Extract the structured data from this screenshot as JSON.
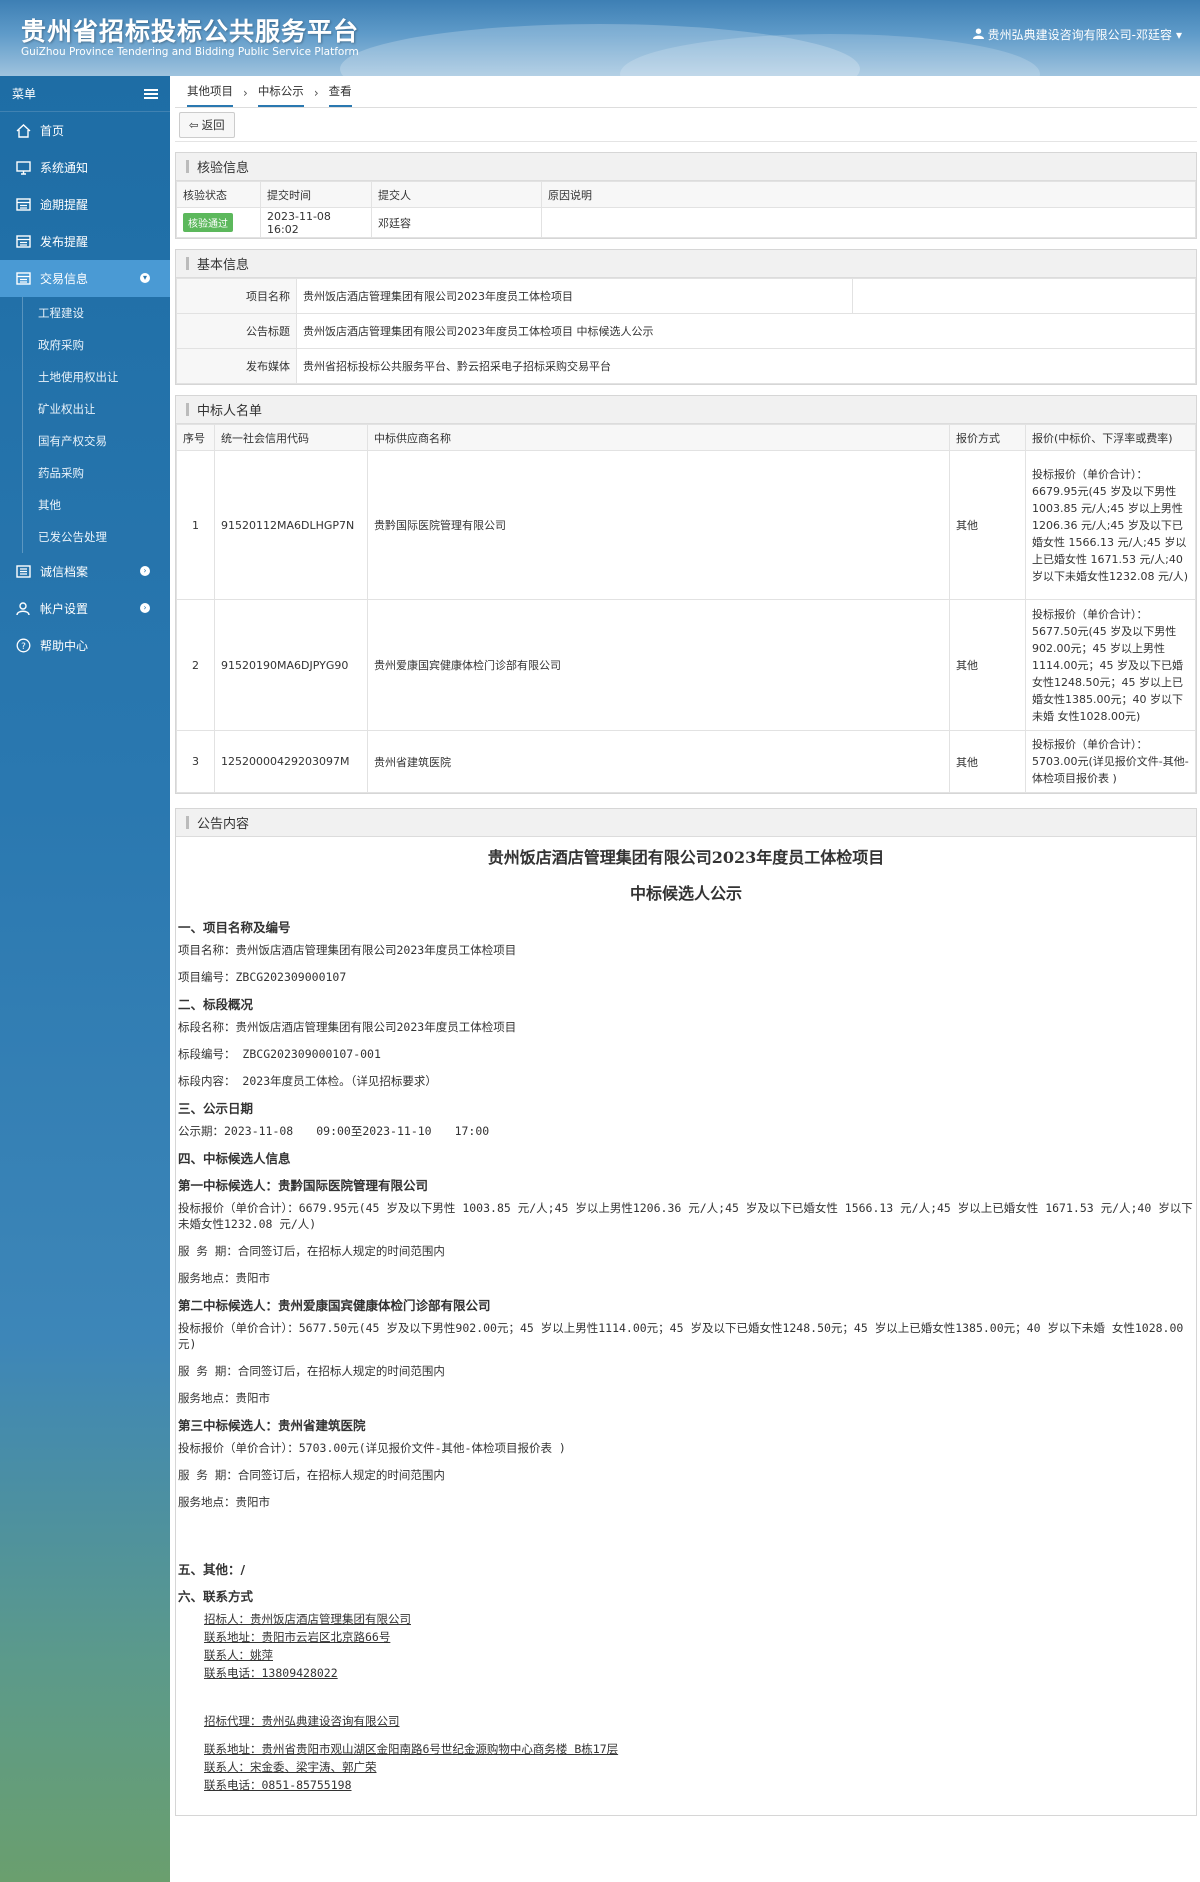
{
  "header": {
    "title": "贵州省招标投标公共服务平台",
    "subtitle": "GuiZhou Province Tendering and Bidding Public Service Platform",
    "user": "贵州弘典建设咨询有限公司-邓廷容"
  },
  "sidebar": {
    "menu_label": "菜单",
    "items": [
      {
        "label": "首页",
        "icon": "home-icon"
      },
      {
        "label": "系统通知",
        "icon": "monitor-icon"
      },
      {
        "label": "逾期提醒",
        "icon": "list-icon"
      },
      {
        "label": "发布提醒",
        "icon": "list-icon"
      },
      {
        "label": "交易信息",
        "icon": "list-icon"
      }
    ],
    "sub_items": [
      "工程建设",
      "政府采购",
      "土地使用权出让",
      "矿业权出让",
      "国有产权交易",
      "药品采购",
      "其他",
      "已发公告处理"
    ],
    "bottom_items": [
      {
        "label": "诚信档案",
        "icon": "list-icon"
      },
      {
        "label": "帐户设置",
        "icon": "user-icon"
      },
      {
        "label": "帮助中心",
        "icon": "help-icon"
      }
    ]
  },
  "breadcrumb": [
    "其他项目",
    "中标公示",
    "查看"
  ],
  "toolbar": {
    "back_label": "返回"
  },
  "verify": {
    "title": "核验信息",
    "headers": [
      "核验状态",
      "提交时间",
      "提交人",
      "原因说明"
    ],
    "status": "核验通过",
    "time": "2023-11-08 16:02",
    "submitter": "邓廷容",
    "reason": ""
  },
  "basic": {
    "title": "基本信息",
    "rows": [
      {
        "label": "项目名称",
        "value": "贵州饭店酒店管理集团有限公司2023年度员工体检项目"
      },
      {
        "label": "公告标题",
        "value": "贵州饭店酒店管理集团有限公司2023年度员工体检项目 中标候选人公示"
      },
      {
        "label": "发布媒体",
        "value": "贵州省招标投标公共服务平台、黔云招采电子招标采购交易平台"
      }
    ]
  },
  "winners": {
    "title": "中标人名单",
    "headers": [
      "序号",
      "统一社会信用代码",
      "中标供应商名称",
      "报价方式",
      "报价(中标价、下浮率或费率)"
    ],
    "rows": [
      {
        "no": "1",
        "code": "91520112MA6DLHGP7N",
        "name": "贵黔国际医院管理有限公司",
        "method": "其他",
        "price": "投标报价（单价合计）：6679.95元(45 岁及以下男性1003.85 元/人;45 岁以上男性1206.36 元/人;45 岁及以下已婚女性 1566.13 元/人;45 岁以上已婚女性 1671.53 元/人;40 岁以下未婚女性1232.08 元/人)"
      },
      {
        "no": "2",
        "code": "91520190MA6DJPYG90",
        "name": "贵州爱康国宾健康体检门诊部有限公司",
        "method": "其他",
        "price": "投标报价（单价合计）：5677.50元(45 岁及以下男性902.00元；45 岁以上男性1114.00元；45 岁及以下已婚女性1248.50元；45 岁以上已婚女性1385.00元；40 岁以下未婚 女性1028.00元)"
      },
      {
        "no": "3",
        "code": "12520000429203097M",
        "name": "贵州省建筑医院",
        "method": "其他",
        "price": "投标报价（单价合计）：5703.00元(详见报价文件-其他-体检项目报价表 )"
      }
    ]
  },
  "notice": {
    "title": "公告内容",
    "heading1": "贵州饭店酒店管理集团有限公司2023年度员工体检项目",
    "heading2": "中标候选人公示",
    "s1": "一、项目名称及编号",
    "s1_p1": "项目名称：贵州饭店酒店管理集团有限公司2023年度员工体检项目",
    "s1_p2": "项目编号：ZBCG202309000107",
    "s2": "二、标段概况",
    "s2_p1": "标段名称：贵州饭店酒店管理集团有限公司2023年度员工体检项目",
    "s2_p2": "标段编号： ZBCG202309000107-001",
    "s2_p3": "标段内容： 2023年度员工体检。（详见招标要求）",
    "s3": "三、公示日期",
    "s3_p1": "公示期：2023-11-08　　09:00至2023-11-10　　17:00",
    "s4": "四、中标候选人信息",
    "c1": "第一中标候选人：贵黔国际医院管理有限公司",
    "c1_price": "投标报价（单价合计）：6679.95元(45 岁及以下男性 1003.85 元/人;45 岁以上男性1206.36 元/人;45 岁及以下已婚女性 1566.13 元/人;45 岁以上已婚女性 1671.53 元/人;40 岁以下未婚女性1232.08 元/人)",
    "c1_period": "服 务 期：合同签订后，在招标人规定的时间范围内",
    "c1_place": "服务地点：贵阳市",
    "c2": "第二中标候选人：贵州爱康国宾健康体检门诊部有限公司",
    "c2_price": "投标报价（单价合计）：5677.50元(45 岁及以下男性902.00元；45 岁以上男性1114.00元；45 岁及以下已婚女性1248.50元；45 岁以上已婚女性1385.00元；40 岁以下未婚 女性1028.00元)",
    "c2_period": "服 务 期：合同签订后，在招标人规定的时间范围内",
    "c2_place": "服务地点：贵阳市",
    "c3": "第三中标候选人：贵州省建筑医院",
    "c3_price": "投标报价（单价合计）：5703.00元(详见报价文件-其他-体检项目报价表 )",
    "c3_period": "服 务 期：合同签订后，在招标人规定的时间范围内",
    "c3_place": "服务地点：贵阳市",
    "s5": "五、其他：/",
    "s6": "六、联系方式",
    "contact1": [
      "招标人：贵州饭店酒店管理集团有限公司",
      "联系地址：贵阳市云岩区北京路66号",
      "联系人：姚萍",
      "联系电话：13809428022"
    ],
    "contact2": [
      "招标代理：贵州弘典建设咨询有限公司",
      "联系地址：贵州省贵阳市观山湖区金阳南路6号世纪金源购物中心商务楼 B栋17层",
      "联系人：宋金委、梁宇涛、郭广荣",
      "联系电话：0851-85755198"
    ]
  }
}
